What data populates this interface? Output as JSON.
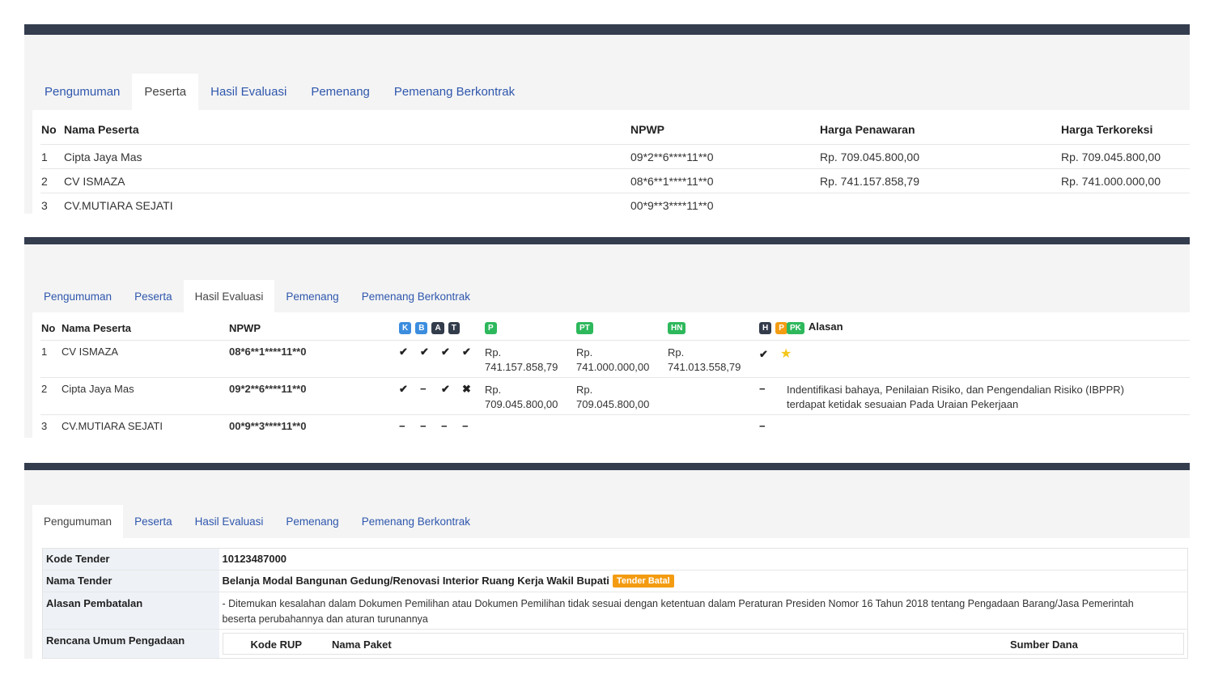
{
  "panel1": {
    "tabs": [
      "Pengumuman",
      "Peserta",
      "Hasil Evaluasi",
      "Pemenang",
      "Pemenang Berkontrak"
    ],
    "headers": [
      "No",
      "Nama Peserta",
      "NPWP",
      "Harga Penawaran",
      "Harga Terkoreksi"
    ],
    "rows": [
      {
        "no": "1",
        "nama": "Cipta Jaya Mas",
        "npwp": "09*2**6****11**0",
        "penawaran": "Rp. 709.045.800,00",
        "terkoreksi": "Rp. 709.045.800,00"
      },
      {
        "no": "2",
        "nama": "CV ISMAZA",
        "npwp": "08*6**1****11**0",
        "penawaran": "Rp. 741.157.858,79",
        "terkoreksi": "Rp. 741.000.000,00"
      },
      {
        "no": "3",
        "nama": "CV.MUTIARA SEJATI",
        "npwp": "00*9**3****11**0",
        "penawaran": "",
        "terkoreksi": ""
      }
    ]
  },
  "panel2": {
    "tabs": [
      "Pengumuman",
      "Peserta",
      "Hasil Evaluasi",
      "Pemenang",
      "Pemenang Berkontrak"
    ],
    "headers": {
      "no": "No",
      "nama": "Nama Peserta",
      "npwp": "NPWP",
      "alasan": "Alasan"
    },
    "badges": {
      "k": "K",
      "b": "B",
      "a": "A",
      "t": "T",
      "p": "P",
      "pt": "PT",
      "hn": "HN",
      "h": "H",
      "p2": "P",
      "pk": "PK"
    },
    "badge_colors": {
      "blue": "#3c8dde",
      "dark": "#333c4b",
      "green": "#2eb85c",
      "orange": "#f39c12"
    },
    "rows": [
      {
        "no": "1",
        "nama": "CV ISMAZA",
        "npwp": "08*6**1****11**0",
        "k": "✔",
        "b": "✔",
        "a": "✔",
        "t": "✔",
        "p_rp": "Rp.",
        "p_val": "741.157.858,79",
        "pt_rp": "Rp.",
        "pt_val": "741.000.000,00",
        "hn_rp": "Rp.",
        "hn_val": "741.013.558,79",
        "h": "✔",
        "star": "★",
        "alasan1": "",
        "alasan2": ""
      },
      {
        "no": "2",
        "nama": "Cipta Jaya Mas",
        "npwp": "09*2**6****11**0",
        "k": "✔",
        "b": "−",
        "a": "✔",
        "t": "✖",
        "p_rp": "Rp.",
        "p_val": "709.045.800,00",
        "pt_rp": "Rp.",
        "pt_val": "709.045.800,00",
        "hn_rp": "",
        "hn_val": "",
        "h": "−",
        "star": "",
        "alasan1": "Indentifikasi bahaya, Penilaian Risiko, dan Pengendalian Risiko (IBPPR)",
        "alasan2": "terdapat ketidak sesuaian Pada Uraian Pekerjaan"
      },
      {
        "no": "3",
        "nama": "CV.MUTIARA SEJATI",
        "npwp": "00*9**3****11**0",
        "k": "−",
        "b": "−",
        "a": "−",
        "t": "−",
        "p_rp": "",
        "p_val": "",
        "pt_rp": "",
        "pt_val": "",
        "hn_rp": "",
        "hn_val": "",
        "h": "−",
        "star": "",
        "alasan1": "",
        "alasan2": ""
      }
    ]
  },
  "panel3": {
    "tabs": [
      "Pengumuman",
      "Peserta",
      "Hasil Evaluasi",
      "Pemenang",
      "Pemenang Berkontrak"
    ],
    "kode_label": "Kode Tender",
    "kode_value": "10123487000",
    "nama_label": "Nama Tender",
    "nama_value": "Belanja Modal Bangunan Gedung/Renovasi Interior Ruang Kerja Wakil Bupati",
    "status": "Tender Batal",
    "alasan_label": "Alasan Pembatalan",
    "alasan_line1": "- Ditemukan kesalahan dalam Dokumen Pemilihan atau Dokumen Pemilihan tidak sesuai dengan ketentuan dalam Peraturan Presiden Nomor 16 Tahun 2018 tentang Pengadaan Barang/Jasa Pemerintah",
    "alasan_line2": "beserta perubahannya dan aturan turunannya",
    "rup_label": "Rencana Umum Pengadaan",
    "rup_headers": [
      "Kode RUP",
      "Nama Paket",
      "Sumber Dana"
    ]
  }
}
